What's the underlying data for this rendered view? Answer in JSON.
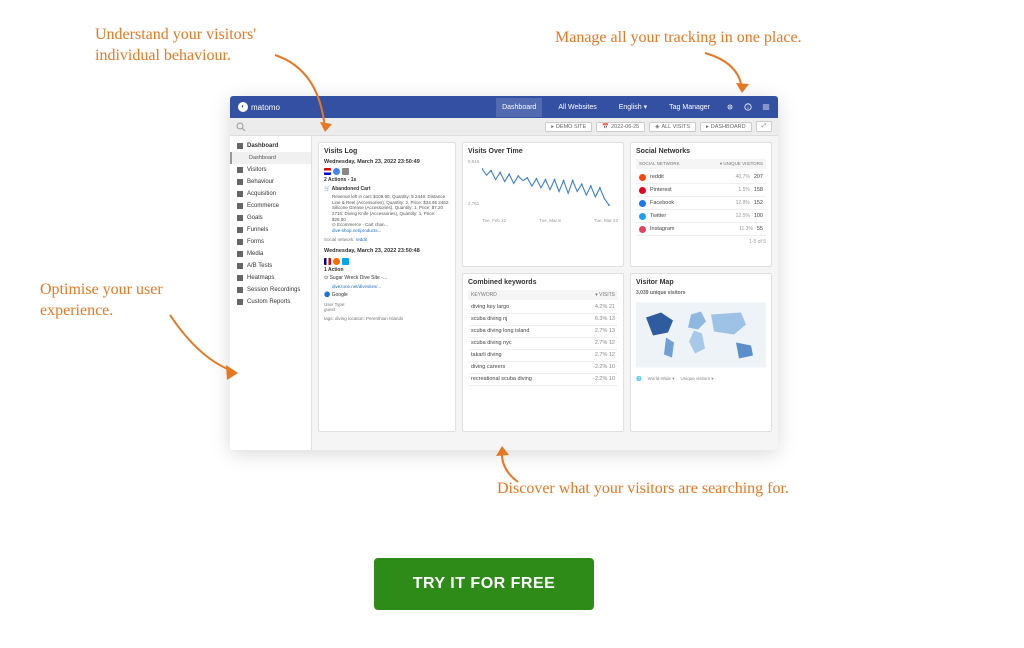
{
  "annotations": {
    "top_left": "Understand your visitors' individual behaviour.",
    "top_right": "Manage all your tracking in one place.",
    "mid_left": "Optimise your user experience.",
    "bottom": "Discover what your visitors are searching for."
  },
  "brand": "matomo",
  "topnav": {
    "dashboard": "Dashboard",
    "all_websites": "All Websites",
    "english": "English ▾",
    "tag_manager": "Tag Manager"
  },
  "filters": {
    "site": "DEMO SITE",
    "date": "2022-06-25",
    "segment": "ALL VISITS",
    "dash": "DASHBOARD"
  },
  "sidebar": {
    "items": [
      {
        "label": "Dashboard",
        "active": true,
        "sub": "Dashboard"
      },
      {
        "label": "Visitors"
      },
      {
        "label": "Behaviour"
      },
      {
        "label": "Acquisition"
      },
      {
        "label": "Ecommerce"
      },
      {
        "label": "Goals"
      },
      {
        "label": "Funnels"
      },
      {
        "label": "Forms"
      },
      {
        "label": "Media"
      },
      {
        "label": "A/B Tests"
      },
      {
        "label": "Heatmaps"
      },
      {
        "label": "Session Recordings"
      },
      {
        "label": "Custom Reports"
      }
    ]
  },
  "cards": {
    "visits_log": {
      "title": "Visits Log",
      "entries": [
        {
          "date": "Wednesday, March 23, 2022 23:50:49",
          "actions": "2 Actions - 1s",
          "icon_label": "Abandoned Cart",
          "detail": "Revenue left in cart: $109.90, Quantity: 5 2449: Distance Line & Reel (Accessories), Quantity: 2, Price: $34.95 2462: Silicone Grease (Accessories), Quantity: 1, Price: $7.20 2716: Diving Knife (Accessories), Quantity: 1, Price: $26.00",
          "sub_action": "Ecommerce - Cart chan...",
          "sub_link": "dive-shop.net/products...",
          "sntext": "Social network:",
          "snval": "reddit"
        },
        {
          "date": "Wednesday, March 23, 2022 23:50:48",
          "actions": "1 Action",
          "icon_label": "Sugar Wreck Dive Site -...",
          "sub_link": "divezone.net/divesites/...",
          "source": "Google",
          "usertype_label": "User Type:",
          "usertype": "guest",
          "tags": "tags: diving location: Perenthian Islands"
        }
      ]
    },
    "visits_over_time": {
      "title": "Visits Over Time",
      "y_top": "5,516",
      "y_bot": "2,761",
      "x_left": "Tue, Feb 22",
      "x_mid": "Tue, Mar 8",
      "x_right": "Tue, Mar 22"
    },
    "combined_keywords": {
      "title": "Combined keywords",
      "col1": "KEYWORD",
      "col2": "▾ VISITS",
      "rows": [
        {
          "kw": "diving key largo",
          "v": "4.2% 21"
        },
        {
          "kw": "scuba diving nj",
          "v": "6.3% 13"
        },
        {
          "kw": "scuba diving long island",
          "v": "2.7% 13"
        },
        {
          "kw": "scuba diving nyc",
          "v": "2.7% 12"
        },
        {
          "kw": "takarli diving",
          "v": "2.7% 12"
        },
        {
          "kw": "diving careers",
          "v": "-2.2% 10"
        },
        {
          "kw": "recreational scuba diving",
          "v": "-2.2% 10"
        }
      ]
    },
    "social": {
      "title": "Social Networks",
      "col1": "SOCIAL NETWORK",
      "col2": "▾ UNIQUE VISITORS",
      "rows": [
        {
          "name": "reddit",
          "pct": "40.7%",
          "num": "207",
          "color": "#ff4500"
        },
        {
          "name": "Pinterest",
          "pct": "1.5%",
          "num": "158",
          "color": "#e60023"
        },
        {
          "name": "Facebook",
          "pct": "12.8%",
          "num": "152",
          "color": "#1877f2"
        },
        {
          "name": "Twitter",
          "pct": "12.5%",
          "num": "100",
          "color": "#1da1f2"
        },
        {
          "name": "Instagram",
          "pct": "11.3%",
          "num": "55",
          "color": "#e4405f"
        }
      ],
      "footer": "1-5 of 5"
    },
    "visitor_map": {
      "title": "Visitor Map",
      "subtitle": "3,039 unique visitors",
      "footer_a": "World-Wide ▾",
      "footer_b": "Unique visitors ▾"
    }
  },
  "chart_data": {
    "type": "line",
    "title": "Visits Over Time",
    "xlabel": "",
    "ylabel": "",
    "ylim": [
      2761,
      5516
    ],
    "x_ticks": [
      "Tue, Feb 22",
      "Tue, Mar 8",
      "Tue, Mar 22"
    ],
    "series": [
      {
        "name": "Visits",
        "values": [
          5100,
          4700,
          5000,
          4400,
          4800,
          4300,
          4700,
          4200,
          4600,
          4300,
          4500,
          4000,
          4400,
          3900,
          4300,
          3800,
          4300,
          3700,
          4200,
          3600,
          4200,
          3700,
          4000,
          3500,
          3900,
          3400,
          3800,
          3300,
          2900
        ]
      }
    ]
  },
  "cta": "TRY IT FOR FREE"
}
